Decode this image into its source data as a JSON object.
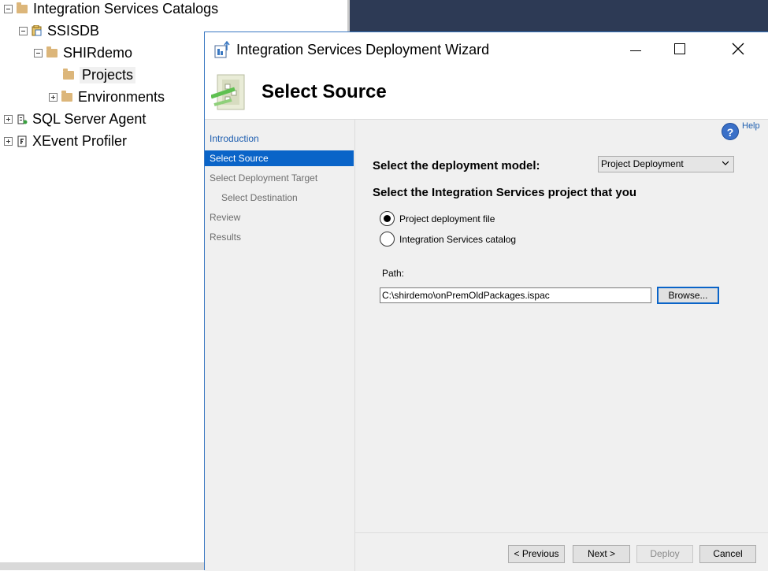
{
  "object_explorer": {
    "items": [
      {
        "label": "Integration Services Catalogs"
      },
      {
        "label": "SSISDB"
      },
      {
        "label": "SHIRdemo"
      },
      {
        "label": "Projects"
      },
      {
        "label": "Environments"
      },
      {
        "label": "SQL Server Agent"
      },
      {
        "label": "XEvent Profiler"
      }
    ]
  },
  "wizard": {
    "title": "Integration Services Deployment Wizard",
    "page_title": "Select Source",
    "help_label": "Help",
    "nav": [
      {
        "label": "Introduction",
        "state": "link"
      },
      {
        "label": "Select Source",
        "state": "active"
      },
      {
        "label": "Select Deployment Target",
        "state": "disabled"
      },
      {
        "label": "Select Destination",
        "state": "disabled"
      },
      {
        "label": "Review",
        "state": "disabled"
      },
      {
        "label": "Results",
        "state": "disabled"
      }
    ],
    "deployment_model_label": "Select the deployment model:",
    "deployment_model_value": "Project Deployment",
    "project_prompt": "Select the Integration Services project that you",
    "source_options": [
      {
        "label": "Project deployment file",
        "selected": true
      },
      {
        "label": "Integration Services catalog",
        "selected": false
      }
    ],
    "path_label": "Path:",
    "path_value": "C:\\shirdemo\\onPremOldPackages.ispac",
    "browse_label": "Browse...",
    "buttons": {
      "previous": "< Previous",
      "next": "Next >",
      "deploy": "Deploy",
      "cancel": "Cancel"
    }
  },
  "colors": {
    "accent": "#0a64c8",
    "link": "#1f5fb0",
    "background_dark": "#2d3a55"
  }
}
